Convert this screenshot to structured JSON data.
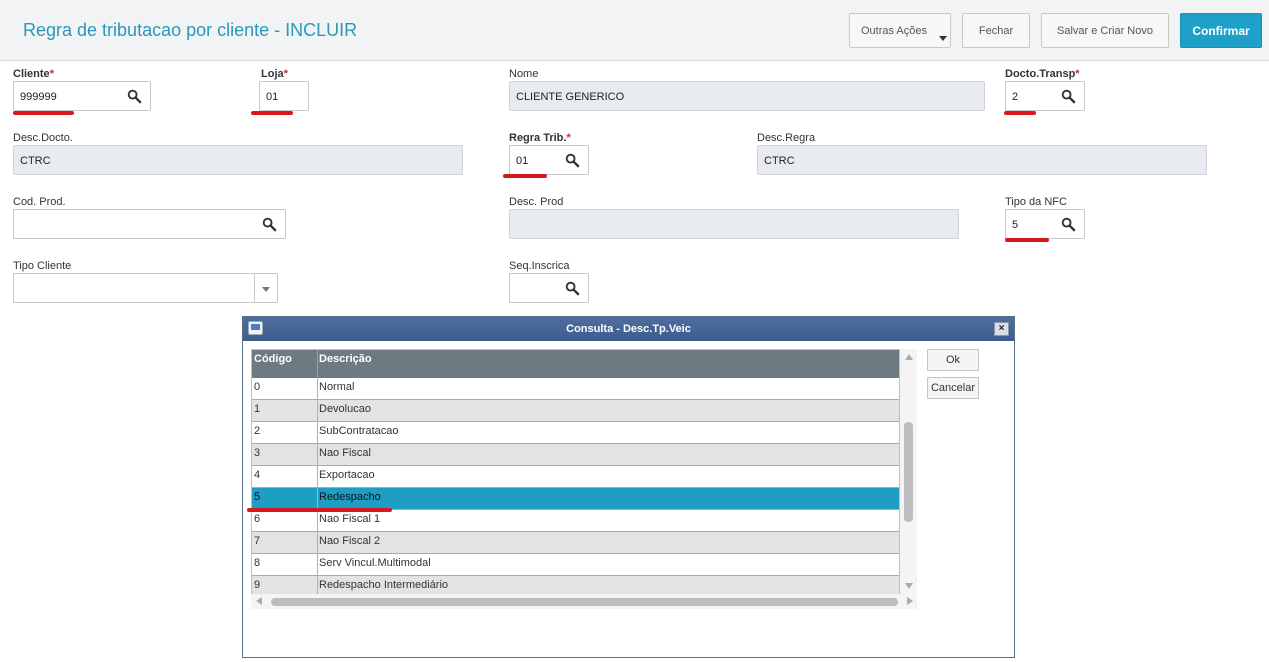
{
  "header": {
    "title": "Regra de tributacao por cliente - INCLUIR",
    "buttons": {
      "more": "Outras Ações",
      "close": "Fechar",
      "save_new": "Salvar e Criar Novo",
      "confirm": "Confirmar"
    }
  },
  "form": {
    "cliente": {
      "label": "Cliente",
      "value": "999999"
    },
    "loja": {
      "label": "Loja",
      "value": "01"
    },
    "nome": {
      "label": "Nome",
      "value": "CLIENTE GENERICO"
    },
    "docto_transp": {
      "label": "Docto.Transp",
      "value": "2"
    },
    "desc_docto": {
      "label": "Desc.Docto.",
      "value": "CTRC"
    },
    "regra_trib": {
      "label": "Regra Trib.",
      "value": "01"
    },
    "desc_regra": {
      "label": "Desc.Regra",
      "value": "CTRC"
    },
    "cod_prod": {
      "label": "Cod. Prod.",
      "value": ""
    },
    "desc_prod": {
      "label": "Desc. Prod",
      "value": ""
    },
    "tipo_nfc": {
      "label": "Tipo da NFC",
      "value": "5"
    },
    "tipo_cliente": {
      "label": "Tipo Cliente",
      "value": ""
    },
    "seq_inscrica": {
      "label": "Seq.Inscrica",
      "value": ""
    },
    "required_mark": "*"
  },
  "dialog": {
    "title": "Consulta - Desc.Tp.Veic",
    "close_glyph": "×",
    "columns": [
      "Código",
      "Descrição"
    ],
    "rows": [
      [
        "0",
        "Normal"
      ],
      [
        "1",
        "Devolucao"
      ],
      [
        "2",
        "SubContratacao"
      ],
      [
        "3",
        "Nao Fiscal"
      ],
      [
        "4",
        "Exportacao"
      ],
      [
        "5",
        "Redespacho"
      ],
      [
        "6",
        "Nao Fiscal 1"
      ],
      [
        "7",
        "Nao Fiscal 2"
      ],
      [
        "8",
        "Serv Vincul.Multimodal"
      ],
      [
        "9",
        "Redespacho Intermediário"
      ]
    ],
    "selected_index": 5,
    "ok": "Ok",
    "cancel": "Cancelar"
  },
  "colors": {
    "accent": "#1fa0c8",
    "title": "#2a98b8",
    "selected_row": "#1f9ec4",
    "annotation_red": "#d8181e",
    "required": "#d9262a"
  }
}
